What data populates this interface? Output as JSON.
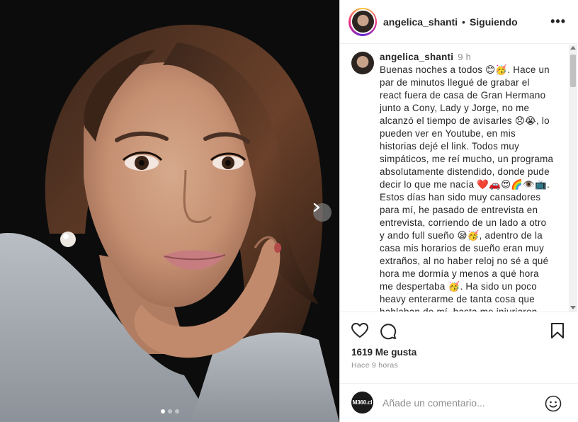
{
  "post": {
    "username": "angelica_shanti",
    "separator": "•",
    "follow_status": "Siguiendo",
    "more_label": "•••",
    "caption": {
      "username": "angelica_shanti",
      "time": "9 h",
      "text": "Buenas noches a todos 😊🥳. Hace un par de minutos llegué de grabar el react fuera de casa de Gran Hermano junto a Cony, Lady y Jorge, no me alcanzó el tiempo de avisarles 😞😭, lo pueden ver en Youtube, en mis historias dejé el link. Todos muy simpáticos, me reí mucho, un programa absolutamente distendido, donde pude decir lo que me nacía ❤️🚗😍🌈👁️📺. Estos días han sido muy cansadores para mí, he pasado de entrevista en entrevista, corriendo de un lado a otro y ando full sueño 😪🥳, adentro de la casa mis horarios de sueño eran muy extraños, al no haber reloj no sé a qué hora me dormía y menos a qué hora me despertaba 🥳. Ha sido un poco heavy enterarme de tanta cosa que hablaban de mí, hasta me injuriaron que estaba"
    },
    "likes": "1619 Me gusta",
    "posted_ago": "Hace 9 horas",
    "comment": {
      "placeholder": "Añade un comentario...",
      "commenter_logo": "M360.cl"
    },
    "carousel": {
      "total": 3,
      "active_index": 0
    },
    "icons": {
      "like": "heart-icon",
      "comment": "comment-bubble-icon",
      "save": "bookmark-icon",
      "next": "chevron-right-icon",
      "emoji": "smiley-icon"
    }
  }
}
